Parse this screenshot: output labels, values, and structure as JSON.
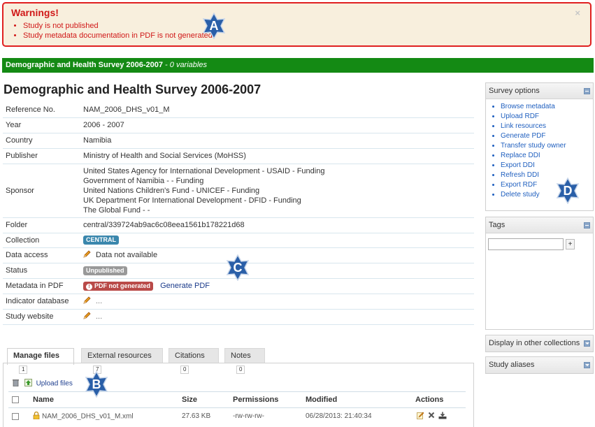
{
  "warning": {
    "title": "Warnings!",
    "close": "×",
    "items": [
      "Study is not published",
      "Study metadata documentation in PDF is not generated"
    ]
  },
  "markers": {
    "a": "A",
    "b": "B",
    "c": "C",
    "d": "D"
  },
  "study_bar": {
    "title": "Demographic and Health Survey 2006-2007",
    "separator": " - ",
    "variables": "0 variables"
  },
  "page_title": "Demographic and Health Survey 2006-2007",
  "info": {
    "reference": {
      "label": "Reference No.",
      "value": "NAM_2006_DHS_v01_M"
    },
    "year": {
      "label": "Year",
      "value": "2006 - 2007"
    },
    "country": {
      "label": "Country",
      "value": "Namibia"
    },
    "publisher": {
      "label": "Publisher",
      "value": "Ministry of Health and Social Services (MoHSS)"
    },
    "sponsor": {
      "label": "Sponsor",
      "lines": [
        "United States Agency for International Development - USAID - Funding",
        "Government of Namibia - - Funding",
        "United Nations Children's Fund - UNICEF - Funding",
        "UK Department For International Development - DFID - Funding",
        "The Global Fund - -"
      ]
    },
    "folder": {
      "label": "Folder",
      "value": "central/339724ab9ac6c08eea1561b178221d68"
    },
    "collection": {
      "label": "Collection",
      "value": "CENTRAL"
    },
    "data_access": {
      "label": "Data access",
      "value": "Data not available"
    },
    "status": {
      "label": "Status",
      "value": "Unpublished"
    },
    "metadata_pdf": {
      "label": "Metadata in PDF",
      "badge": "PDF not generated",
      "link": "Generate PDF"
    },
    "indicator_db": {
      "label": "Indicator database",
      "value": "..."
    },
    "website": {
      "label": "Study website",
      "value": "..."
    }
  },
  "tabs": [
    {
      "label": "Manage files",
      "count": "1"
    },
    {
      "label": "External resources",
      "count": "7"
    },
    {
      "label": "Citations",
      "count": "0"
    },
    {
      "label": "Notes",
      "count": "0"
    }
  ],
  "files": {
    "upload_label": "Upload files",
    "columns": [
      "Name",
      "Size",
      "Permissions",
      "Modified",
      "Actions"
    ],
    "rows": [
      {
        "name": "NAM_2006_DHS_v01_M.xml",
        "size": "27.63 KB",
        "permissions": "-rw-rw-rw-",
        "modified": "06/28/2013: 21:40:34"
      }
    ]
  },
  "sidebar": {
    "survey_options": {
      "title": "Survey options",
      "items": [
        "Browse metadata",
        "Upload RDF",
        "Link resources",
        "Generate PDF",
        "Transfer study owner",
        "Replace DDI",
        "Export DDI",
        "Refresh DDI",
        "Export RDF",
        "Delete study"
      ]
    },
    "tags": {
      "title": "Tags",
      "add": "+"
    },
    "other_collections": {
      "title": "Display in other collections"
    },
    "aliases": {
      "title": "Study aliases"
    }
  },
  "colors": {
    "accent_green": "#148a14",
    "warning_red": "#d01818",
    "marker_blue": "#2a5fa8",
    "link_blue": "#1f5fbf"
  }
}
